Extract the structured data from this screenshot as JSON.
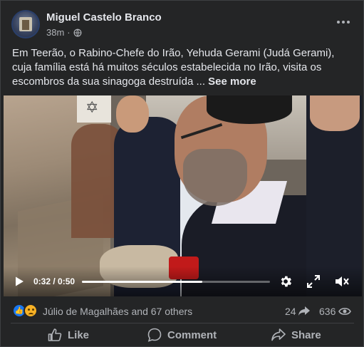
{
  "post": {
    "author": "Miguel Castelo Branco",
    "time": "38m",
    "separator": "·",
    "body": "Em Teerão, o Rabino-Chefe do Irão, Yehuda Gerami (Judá Gerami), cuja família está há muitos séculos estabelecida no Irão, visita os escombros da sua sinagoga destruída ...",
    "see_more": "See more"
  },
  "video": {
    "current_time": "0:32",
    "duration": "0:50",
    "time_sep": " / ",
    "progress": 0.64
  },
  "stats": {
    "reactors": "Júlio de Magalhães and 67 others",
    "shares": "24",
    "views": "636"
  },
  "actions": {
    "like": "Like",
    "comment": "Comment",
    "share": "Share"
  },
  "icons": {
    "privacy": "globe-icon",
    "more": "more-icon",
    "play": "play-icon",
    "settings": "gear-icon",
    "fullscreen": "fullscreen-icon",
    "volume": "mute-icon",
    "share_count": "share-arrow-icon",
    "views": "eye-icon"
  },
  "colors": {
    "card_bg": "#242526",
    "text_primary": "#e4e6eb",
    "text_secondary": "#b0b3b8",
    "like_blue": "#1877f2",
    "sad_yellow": "#f7b125"
  }
}
